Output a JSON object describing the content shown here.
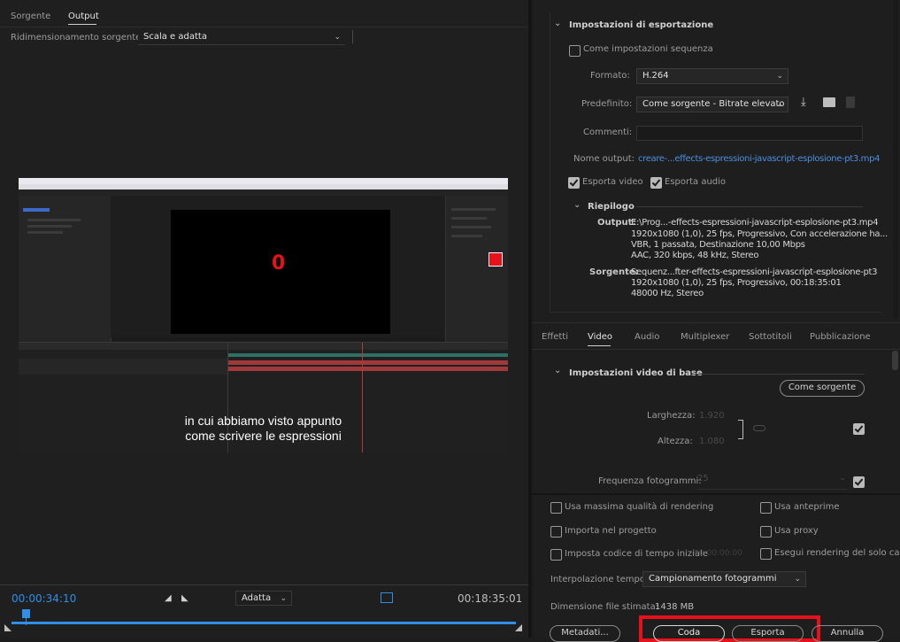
{
  "left": {
    "tabs": [
      {
        "label": "Sorgente"
      },
      {
        "label": "Output"
      }
    ],
    "scaling_label": "Ridimensionamento sorgente:",
    "scaling_value": "Scala e adatta",
    "preview": {
      "overlay_digit": "0",
      "subtitle_line1": "in cui abbiamo visto appunto",
      "subtitle_line2": "come scrivere le espressioni"
    },
    "timecode_current": "00:00:34:10",
    "timecode_total": "00:18:35:01",
    "fit_value": "Adatta"
  },
  "export": {
    "section_title": "Impostazioni di esportazione",
    "match_sequence_label": "Come impostazioni sequenza",
    "format_label": "Formato:",
    "format_value": "H.264",
    "preset_label": "Predefinito:",
    "preset_value": "Come sorgente - Bitrate elevato",
    "comments_label": "Commenti:",
    "comments_value": "",
    "output_name_label": "Nome output:",
    "output_name_value": "creare-...effects-espressioni-javascript-esplosione-pt3.mp4",
    "export_video_label": "Esporta video",
    "export_audio_label": "Esporta audio",
    "summary_title": "Riepilogo",
    "summary_output_label": "Output:",
    "summary_output_lines": [
      "E:\\Prog...-effects-espressioni-javascript-esplosione-pt3.mp4",
      "1920x1080 (1,0), 25 fps, Progressivo, Con accelerazione ha...",
      "VBR, 1 passata, Destinazione 10,00 Mbps",
      "AAC, 320 kbps, 48 kHz, Stereo"
    ],
    "summary_source_label": "Sorgente:",
    "summary_source_lines": [
      "Sequenz...fter-effects-espressioni-javascript-esplosione-pt3",
      "1920x1080 (1,0), 25 fps, Progressivo, 00:18:35:01",
      "48000 Hz, Stereo"
    ]
  },
  "tabs": [
    {
      "label": "Effetti",
      "active": false
    },
    {
      "label": "Video",
      "active": true
    },
    {
      "label": "Audio",
      "active": false
    },
    {
      "label": "Multiplexer",
      "active": false
    },
    {
      "label": "Sottotitoli",
      "active": false
    },
    {
      "label": "Pubblicazione",
      "active": false
    }
  ],
  "video": {
    "section_title": "Impostazioni video di base",
    "match_source_button": "Come sorgente",
    "width_label": "Larghezza:",
    "width_value": "1.920",
    "height_label": "Altezza:",
    "height_value": "1.080",
    "framerate_label": "Frequenza fotogrammi:",
    "framerate_value": "25"
  },
  "bottom": {
    "max_quality_label": "Usa massima qualità di rendering",
    "use_previews_label": "Usa anteprime",
    "import_project_label": "Importa nel progetto",
    "use_proxy_label": "Usa proxy",
    "start_timecode_label": "Imposta codice di tempo iniziale",
    "start_timecode_value": "00:00:00:00",
    "alpha_only_label": "Esegui rendering del solo canale",
    "interpolation_label": "Interpolazione tempo:",
    "interpolation_value": "Campionamento fotogrammi",
    "filesize_label": "Dimensione file stimata:",
    "filesize_value": "1438 MB",
    "metadata_button": "Metadati...",
    "queue_button": "Coda",
    "export_button": "Esporta",
    "cancel_button": "Annulla"
  },
  "colors": {
    "accent_blue": "#2f8ee8",
    "link_blue": "#4a8fe0",
    "highlight_red": "#e8101a",
    "panel_bg": "#232323"
  }
}
